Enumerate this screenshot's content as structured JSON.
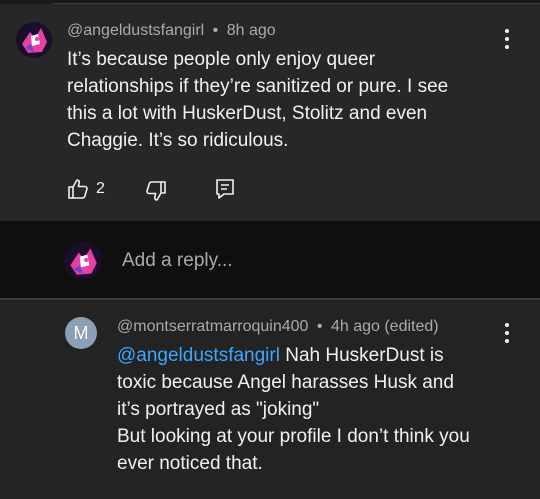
{
  "comment": {
    "username": "@angeldustsfangirl",
    "separator": "•",
    "time": "8h ago",
    "lines": [
      "It’s because people only enjoy queer",
      "relationships if they’re sanitized or pure. I see",
      "this a lot with HuskerDust, Stolitz and even",
      "Chaggie. It’s so ridiculous."
    ],
    "like_count": "2",
    "icons": [
      "like-icon",
      "dislike-icon",
      "reply-icon",
      "more-vert-icon"
    ]
  },
  "reply_box": {
    "placeholder": "Add a reply..."
  },
  "reply": {
    "avatar_letter": "M",
    "username": "@montserratmarroquin400",
    "separator": "•",
    "time": "4h ago (edited)",
    "mention": "@angeldustsfangirl",
    "lines": [
      " Nah HuskerDust is",
      "toxic because Angel harasses Husk and",
      "it’s portrayed as \"joking\"",
      "But looking at your profile I don’t think you",
      "ever noticed that."
    ]
  },
  "colors": {
    "background": "#0f0f0f",
    "comment_bg": "#272727",
    "reply_bg": "#232323",
    "text": "#f1f1f1",
    "meta": "#aaaaaa",
    "mention": "#3ea6ff",
    "avatar_m": "#8aa0b4"
  }
}
